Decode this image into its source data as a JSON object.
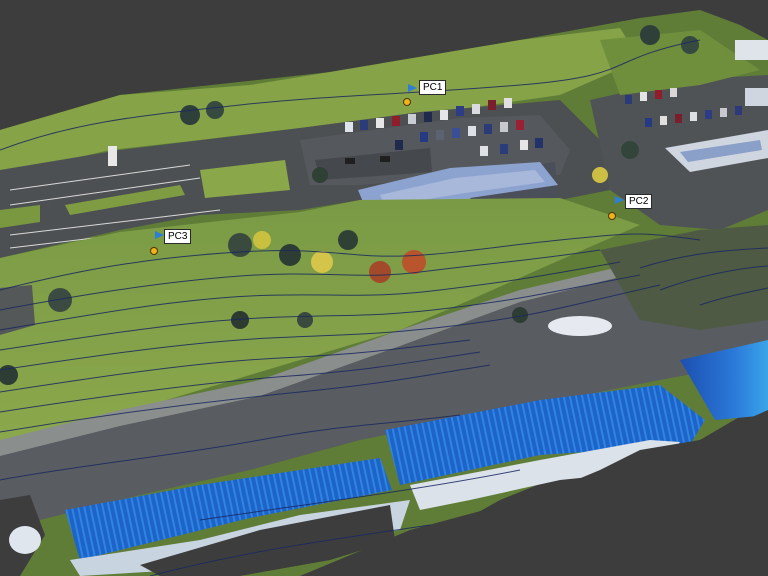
{
  "viewer": {
    "background": "#3d3d3d",
    "model_type": "point-cloud-with-contours"
  },
  "markers": [
    {
      "id": "PC1",
      "label": "PC1",
      "icon": "blue-flag-icon",
      "dot_color": "#f2b21a"
    },
    {
      "id": "PC2",
      "label": "PC2",
      "icon": "blue-flag-icon",
      "dot_color": "#f2b21a"
    },
    {
      "id": "PC3",
      "label": "PC3",
      "icon": "blue-flag-icon",
      "dot_color": "#f2b21a"
    }
  ],
  "colors": {
    "grass": "#6e8f3c",
    "asphalt": "#4a4d50",
    "water": "#1f6fd0",
    "contour": "#1a2860",
    "roof": "#8aa0c8"
  }
}
